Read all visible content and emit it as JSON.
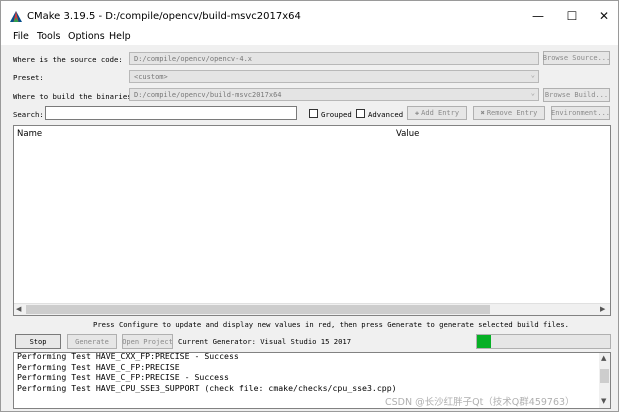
{
  "window": {
    "title": "CMake 3.19.5 - D:/compile/opencv/build-msvc2017x64",
    "minimize_glyph": "—",
    "maximize_glyph": "☐",
    "close_glyph": "✕"
  },
  "menu": [
    "File",
    "Tools",
    "Options",
    "Help"
  ],
  "source": {
    "label": "Where is the source code:",
    "value": "D:/compile/opencv/opencv-4.x",
    "browse_label": "Browse Source..."
  },
  "preset": {
    "label": "Preset:",
    "value": "<custom>"
  },
  "build": {
    "label": "Where to build the binaries:",
    "value": "D:/compile/opencv/build-msvc2017x64",
    "browse_label": "Browse Build..."
  },
  "search": {
    "label": "Search:",
    "value": "",
    "grouped_label": "Grouped",
    "advanced_label": "Advanced",
    "add_entry_label": "Add Entry",
    "remove_entry_label": "Remove Entry",
    "environment_label": "Environment..."
  },
  "table": {
    "columns": [
      "Name",
      "Value"
    ]
  },
  "status_message": "Press Configure to update and display new values in red, then press Generate to generate selected build files.",
  "actions": {
    "stop_label": "Stop",
    "generate_label": "Generate",
    "open_project_label": "Open Project",
    "current_generator": "Current Generator: Visual Studio 15 2017"
  },
  "progress": {
    "fraction": 0.03,
    "color": "#06b025"
  },
  "log_lines": [
    "Performing Test HAVE_CXX_FP:PRECISE - Success",
    "Performing Test HAVE_C_FP:PRECISE",
    "Performing Test HAVE_C_FP:PRECISE - Success",
    "Performing Test HAVE_CPU_SSE3_SUPPORT (check file: cmake/checks/cpu_sse3.cpp)"
  ],
  "watermark": "CSDN @长沙红胖子Qt（技术Q群459763）",
  "icons": {
    "app": "cmake-logo-icon",
    "add": "plus-icon",
    "remove": "cross-icon"
  }
}
